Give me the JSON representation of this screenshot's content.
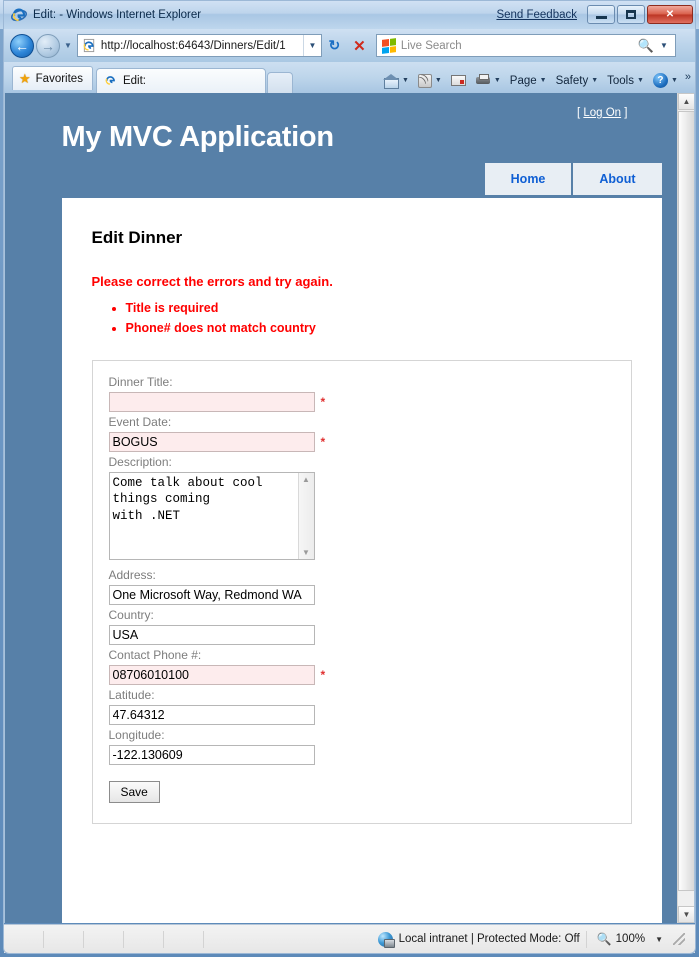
{
  "window": {
    "title": "Edit: - Windows Internet Explorer",
    "send_feedback": "Send Feedback",
    "minimize_label": "Minimize",
    "maximize_label": "Restore",
    "close_label": "Close"
  },
  "navigation": {
    "back_label": "Back",
    "forward_label": "Forward",
    "url": "http://localhost:64643/Dinners/Edit/1",
    "refresh_label": "Refresh",
    "stop_label": "Stop",
    "search_placeholder": "Live Search"
  },
  "tabs": {
    "favorites_label": "Favorites",
    "active_tab": "Edit:",
    "new_tab_label": "New Tab"
  },
  "command_bar": {
    "items": [
      {
        "label": "",
        "icon": "home-icon"
      },
      {
        "label": "",
        "icon": "rss-feed-icon"
      },
      {
        "label": "",
        "icon": "mail-icon"
      },
      {
        "label": "",
        "icon": "print-icon"
      },
      {
        "label": "Page",
        "icon": ""
      },
      {
        "label": "Safety",
        "icon": ""
      },
      {
        "label": "Tools",
        "icon": ""
      },
      {
        "label": "",
        "icon": "help-icon"
      }
    ],
    "overflow": "»"
  },
  "page": {
    "site_title": "My MVC Application",
    "logon_open_bracket": "[",
    "logon_label": "Log On",
    "logon_close_bracket": "]",
    "menu": [
      {
        "label": "Home"
      },
      {
        "label": "About"
      }
    ],
    "heading": "Edit Dinner",
    "validation": {
      "summary": "Please correct the errors and try again.",
      "errors": [
        "Title is required",
        "Phone# does not match country"
      ]
    },
    "fields": [
      {
        "label": "Dinner Title:",
        "value": "",
        "required_marker": "*",
        "error": true,
        "type": "text"
      },
      {
        "label": "Event Date:",
        "value": "BOGUS",
        "required_marker": "*",
        "error": true,
        "type": "text"
      },
      {
        "label": "Description:",
        "value": "Come talk about cool\nthings coming\nwith .NET",
        "required_marker": "",
        "error": false,
        "type": "textarea"
      },
      {
        "label": "Address:",
        "value": "One Microsoft Way, Redmond WA",
        "required_marker": "",
        "error": false,
        "type": "text"
      },
      {
        "label": "Country:",
        "value": "USA",
        "required_marker": "",
        "error": false,
        "type": "text"
      },
      {
        "label": "Contact Phone #:",
        "value": "08706010100",
        "required_marker": "*",
        "error": true,
        "type": "text"
      },
      {
        "label": "Latitude:",
        "value": "47.64312",
        "required_marker": "",
        "error": false,
        "type": "text"
      },
      {
        "label": "Longitude:",
        "value": "-122.130609",
        "required_marker": "",
        "error": false,
        "type": "text"
      }
    ],
    "save_button": "Save"
  },
  "status_bar": {
    "zone_text": "Local intranet | Protected Mode: Off",
    "zoom_level": "100%"
  },
  "colors": {
    "header_blue": "#5780a8",
    "menu_tab_bg": "#e8eef4",
    "menu_link": "#0f5fd4",
    "error_red": "#ff0000",
    "error_field_bg": "#fdeced",
    "label_gray": "#7d7d7d"
  }
}
